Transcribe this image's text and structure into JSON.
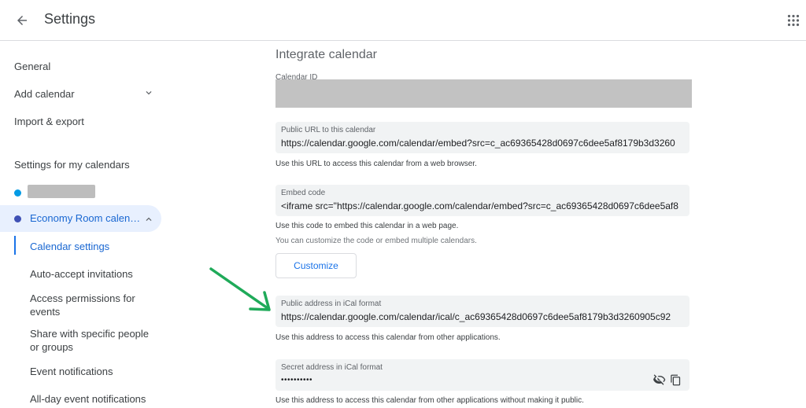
{
  "header": {
    "title": "Settings",
    "back_icon": "arrow-back-icon",
    "apps_icon": "apps-grid-icon"
  },
  "sidebar": {
    "general": "General",
    "add_calendar": "Add calendar",
    "import_export": "Import & export",
    "section_title": "Settings for my calendars",
    "calendars": [
      {
        "name": "",
        "color": "#039be5",
        "redacted": true
      },
      {
        "name": "Economy Room calen…",
        "color": "#3f51b5",
        "active": true
      }
    ],
    "sub_items": [
      {
        "label": "Calendar settings",
        "active": true
      },
      {
        "label": "Auto-accept invitations"
      },
      {
        "label": "Access permissions for events"
      },
      {
        "label": "Share with specific people or groups"
      },
      {
        "label": "Event notifications"
      },
      {
        "label": "All-day event notifications"
      }
    ]
  },
  "main": {
    "section_title": "Integrate calendar",
    "calendar_id": {
      "label": "Calendar ID",
      "redacted": true
    },
    "public_url": {
      "label": "Public URL to this calendar",
      "value": "https://calendar.google.com/calendar/embed?src=c_ac69365428d0697c6dee5af8179b3d3260",
      "helper": "Use this URL to access this calendar from a web browser."
    },
    "embed_code": {
      "label": "Embed code",
      "value": "<iframe src=\"https://calendar.google.com/calendar/embed?src=c_ac69365428d0697c6dee5af8",
      "helper": "Use this code to embed this calendar in a web page.",
      "helper2": "You can customize the code or embed multiple calendars."
    },
    "customize_label": "Customize",
    "ical_public": {
      "label": "Public address in iCal format",
      "value": "https://calendar.google.com/calendar/ical/c_ac69365428d0697c6dee5af8179b3d3260905c92",
      "helper": "Use this address to access this calendar from other applications."
    },
    "ical_secret": {
      "label": "Secret address in iCal format",
      "value": "••••••••••",
      "helper": "Use this address to access this calendar from other applications without making it public.",
      "visibility_icon": "visibility-off-icon",
      "copy_icon": "copy-icon"
    }
  },
  "annotation": {
    "arrow_color": "#1faa59",
    "arrow_icon": "green-pointer-arrow"
  }
}
